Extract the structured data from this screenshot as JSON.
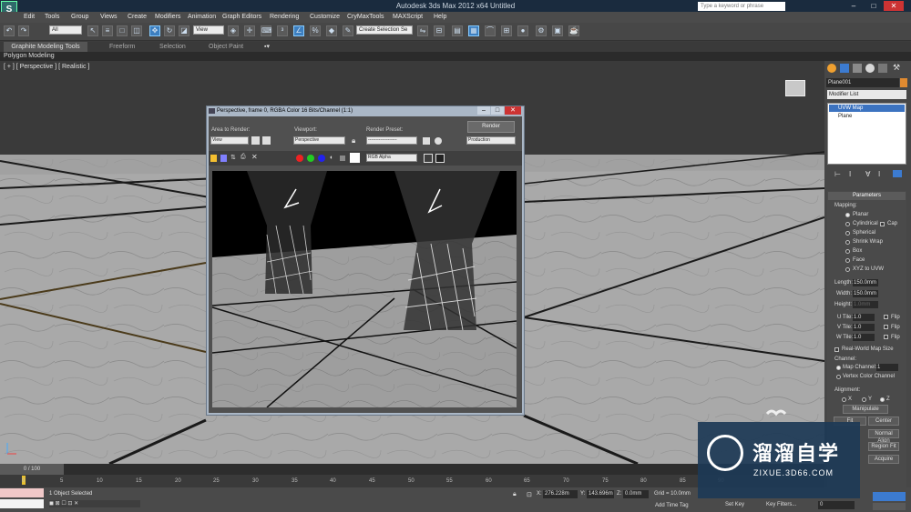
{
  "window": {
    "title": "Autodesk 3ds Max  2012 x64     Untitled",
    "search_placeholder": "Type a keyword or phrase",
    "min": "–",
    "max": "□",
    "close": "✕"
  },
  "menu": [
    "Edit",
    "Tools",
    "Group",
    "Views",
    "Create",
    "Modifiers",
    "Animation",
    "Graph Editors",
    "Rendering",
    "Customize",
    "CryMaxTools",
    "MAXScript",
    "Help"
  ],
  "toolbar": {
    "selection_filter": "All",
    "ref_coord": "View",
    "named_selection": "Create Selection Se"
  },
  "ribbon": {
    "tabs": [
      "Graphite Modeling Tools",
      "Freeform",
      "Selection",
      "Object Paint"
    ],
    "panel": "Polygon Modeling"
  },
  "viewport": {
    "label": "[ + ] [ Perspective ] [ Realistic ]"
  },
  "render_frame": {
    "title": "Perspective, frame 0, RGBA Color 16 Bits/Channel (1:1)",
    "area_label": "Area to Render:",
    "area_value": "View",
    "viewport_label": "Viewport:",
    "viewport_value": "Perspective",
    "preset_label": "Render Preset:",
    "preset_value": "-------------------",
    "render_button": "Render",
    "production_value": "Production",
    "channel_value": "RGB Alpha"
  },
  "command_panel": {
    "object_name": "Plane001",
    "modifier_list": "Modifier List",
    "stack": [
      "UVW Map",
      "Plane"
    ],
    "rollout": "Parameters",
    "mapping_label": "Mapping:",
    "mapping_options": [
      "Planar",
      "Cylindrical",
      "Spherical",
      "Shrink Wrap",
      "Box",
      "Face",
      "XYZ to UVW"
    ],
    "cap_label": "Cap",
    "length_label": "Length:",
    "length_value": "150.0mm",
    "width_label": "Width:",
    "width_value": "150.0mm",
    "height_label": "Height:",
    "height_value": "1.0mm",
    "u_tile_label": "U Tile:",
    "u_tile": "1.0",
    "v_tile_label": "V Tile:",
    "v_tile": "1.0",
    "w_tile_label": "W Tile:",
    "w_tile": "1.0",
    "flip_label": "Flip",
    "real_world": "Real-World Map Size",
    "channel_label": "Channel:",
    "map_channel_label": "Map Channel:",
    "map_channel": "1",
    "vertex_color_channel": "Vertex Color Channel",
    "alignment_label": "Alignment:",
    "axes": [
      "X",
      "Y",
      "Z"
    ],
    "manipulate": "Manipulate",
    "fit": "Fit",
    "center": "Center",
    "normal_align": "Normal Align",
    "region_fit": "Region Fit",
    "acquire": "Acquire"
  },
  "timeline": {
    "slider": "0 / 100",
    "ticks": [
      "0",
      "5",
      "10",
      "15",
      "20",
      "25",
      "30",
      "35",
      "40",
      "45",
      "50",
      "55",
      "60",
      "65",
      "70",
      "75",
      "80",
      "85",
      "90"
    ]
  },
  "status": {
    "objects": "1 Object Selected",
    "x_label": "X:",
    "x": "276.228m",
    "y_label": "Y:",
    "y": "143.696m",
    "z_label": "Z:",
    "z": "0.0mm",
    "grid": "Grid = 10.0mm",
    "add_time_tag": "Add Time Tag",
    "set_key": "Set Key",
    "key_filters": "Key Filters...",
    "frame": "0"
  },
  "watermark": {
    "name": "溜溜自学",
    "url": "ZIXUE.3D66.COM"
  }
}
